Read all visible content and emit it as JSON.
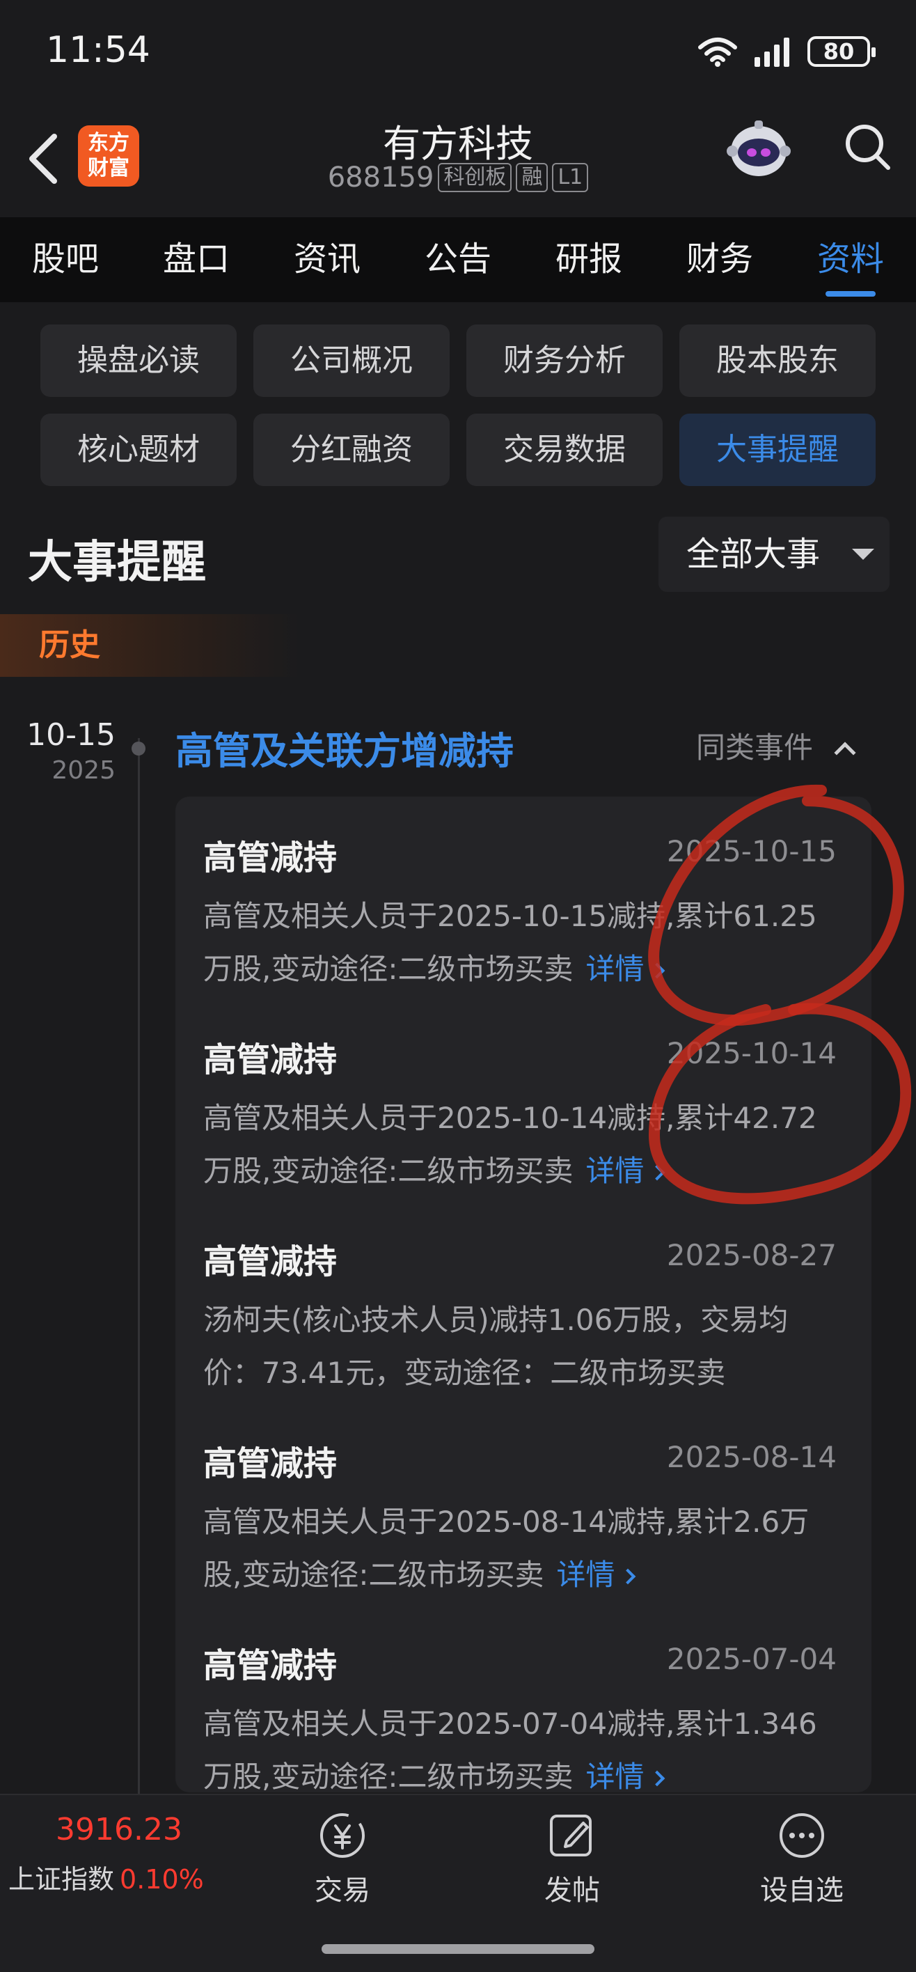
{
  "status_bar": {
    "time": "11:54",
    "battery": "80"
  },
  "header": {
    "brand_logo_text": "东方财富",
    "stock_name": "有方科技",
    "stock_code": "688159",
    "tags": [
      "科创板",
      "融",
      "L1"
    ]
  },
  "main_tabs": [
    "股吧",
    "盘口",
    "资讯",
    "公告",
    "研报",
    "财务",
    "资料"
  ],
  "main_tab_active": "资料",
  "sub_tabs": [
    "操盘必读",
    "公司概况",
    "财务分析",
    "股本股东",
    "核心题材",
    "分红融资",
    "交易数据",
    "大事提醒"
  ],
  "sub_tab_active": "大事提醒",
  "section": {
    "title": "大事提醒",
    "filter": "全部大事"
  },
  "history_label": "历史",
  "timeline": {
    "date": "10-15",
    "year": "2025",
    "event_title": "高管及关联方增减持",
    "similar_label": "同类事件"
  },
  "items": [
    {
      "title": "高管减持",
      "date": "2025-10-15",
      "desc": "高管及相关人员于2025-10-15减持,累计61.25万股,变动途径:二级市场买卖",
      "link": "详情"
    },
    {
      "title": "高管减持",
      "date": "2025-10-14",
      "desc": "高管及相关人员于2025-10-14减持,累计42.72万股,变动途径:二级市场买卖",
      "link": "详情"
    },
    {
      "title": "高管减持",
      "date": "2025-08-27",
      "desc": "汤柯夫(核心技术人员)减持1.06万股，交易均价：73.41元，变动途径：二级市场买卖",
      "link": ""
    },
    {
      "title": "高管减持",
      "date": "2025-08-14",
      "desc": "高管及相关人员于2025-08-14减持,累计2.6万股,变动途径:二级市场买卖",
      "link": "详情"
    },
    {
      "title": "高管减持",
      "date": "2025-07-04",
      "desc": "高管及相关人员于2025-07-04减持,累计1.346万股,变动途径:二级市场买卖",
      "link": "详情"
    }
  ],
  "bottom_bar": {
    "index_value": "3916.23",
    "index_name": "上证指数",
    "index_change": "0.10%",
    "buttons": [
      "交易",
      "发帖",
      "设自选"
    ]
  },
  "colors": {
    "accent": "#3b8be8",
    "up": "#ff3b30",
    "history": "#ff7a2f",
    "annotation": "#c62a1c"
  }
}
